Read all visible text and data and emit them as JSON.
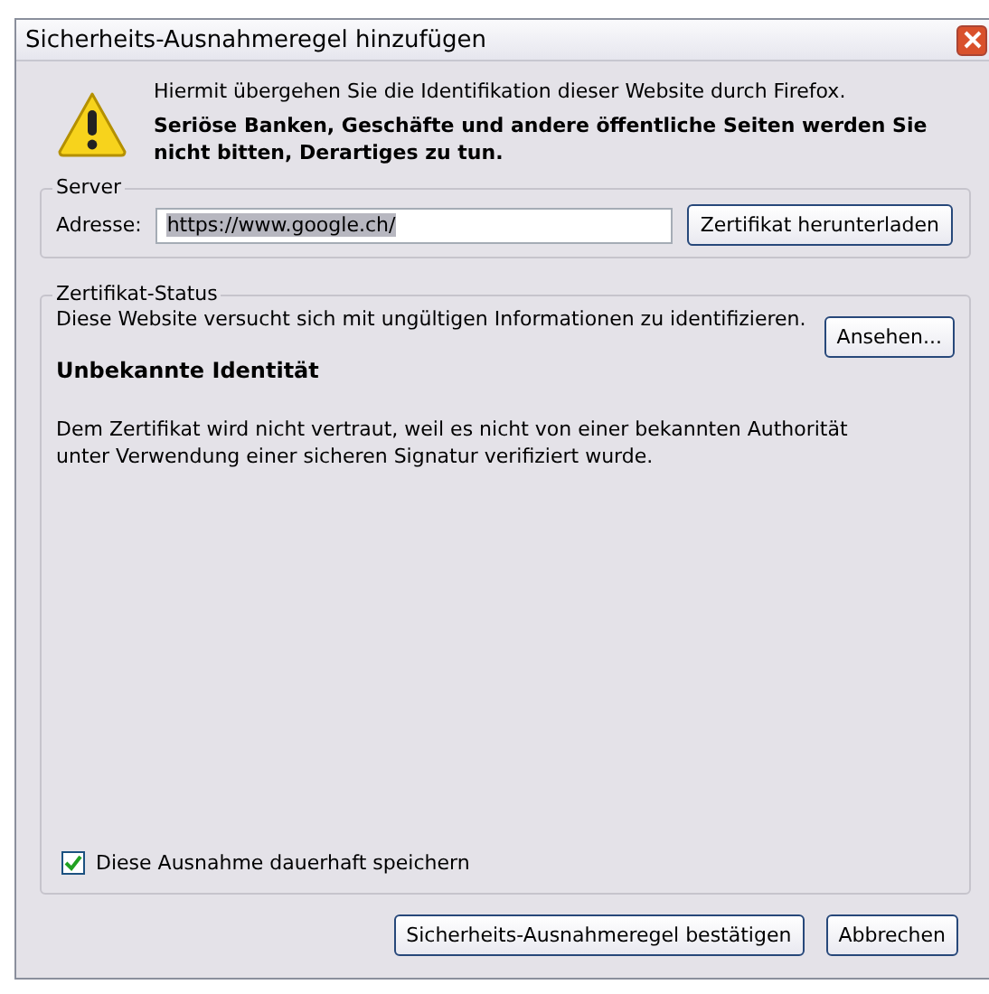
{
  "window": {
    "title": "Sicherheits-Ausnahmeregel hinzufügen"
  },
  "warning": {
    "intro": "Hiermit übergehen Sie die Identifikation dieser Website durch Firefox.",
    "emphasis": "Seriöse Banken, Geschäfte und andere öffentliche Seiten werden Sie nicht bitten, Derartiges zu tun."
  },
  "server": {
    "legend": "Server",
    "address_label": "Adresse:",
    "address_value": "https://www.google.ch/",
    "value_selected": true,
    "download_button": "Zertifikat herunterladen"
  },
  "certificate_status": {
    "legend": "Zertifikat-Status",
    "message": "Diese Website versucht sich mit ungültigen Informationen zu identifizieren.",
    "view_button": "Ansehen...",
    "heading": "Unbekannte Identität",
    "detail": "Dem Zertifikat wird nicht vertraut, weil es nicht von einer bekannten Authorität unter Verwendung einer sicheren Signatur verifiziert wurde."
  },
  "permanent_checkbox": {
    "label": "Diese Ausnahme dauerhaft speichern",
    "checked": true
  },
  "buttons": [
    {
      "label": "Sicherheits-Ausnahmeregel bestätigen"
    },
    {
      "label": "Abbrechen"
    }
  ]
}
